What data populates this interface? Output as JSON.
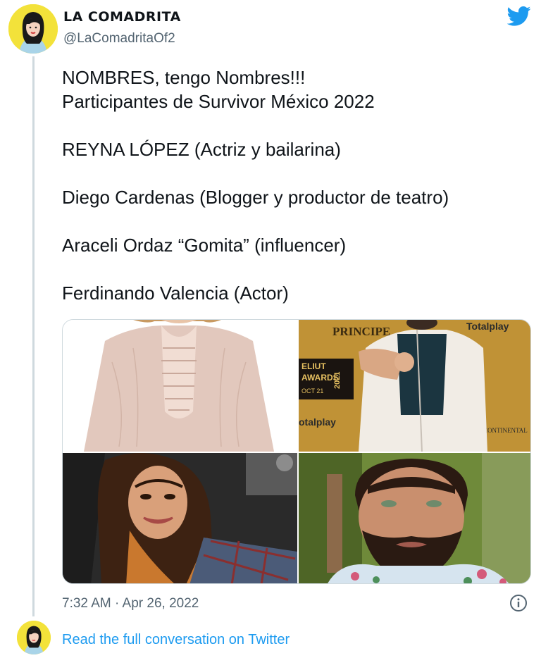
{
  "header": {
    "display_name": "LA COMADRITA",
    "handle": "@LaComadritaOf2"
  },
  "tweet": {
    "lines": [
      "NOMBRES, tengo Nombres!!!",
      "Participantes de Survivor México 2022",
      "",
      "REYNA LÓPEZ (Actriz y bailarina)",
      "",
      "Diego Cardenas (Blogger y productor de teatro)",
      "",
      "Araceli Ordaz “Gomita” (influencer)",
      "",
      "Ferdinando Valencia (Actor)"
    ]
  },
  "event_photo_text": {
    "principe": "PRINCIPE",
    "totalplay": "Totalplay",
    "eliut": "ELIUT",
    "awards": "AWARDS",
    "year": "2021",
    "date": "OCT 21",
    "totalplay_bottom": "otalplay",
    "continental": "CONTINENTAL"
  },
  "footer": {
    "timestamp": "7:32 AM · Apr 26, 2022",
    "read_more": "Read the full conversation on Twitter"
  },
  "icons": {
    "bird": "twitter-bird-icon",
    "info": "info-icon"
  },
  "colors": {
    "brand_blue": "#1d9bf0",
    "secondary_text": "#536471",
    "avatar_bg": "#f3e23a"
  }
}
